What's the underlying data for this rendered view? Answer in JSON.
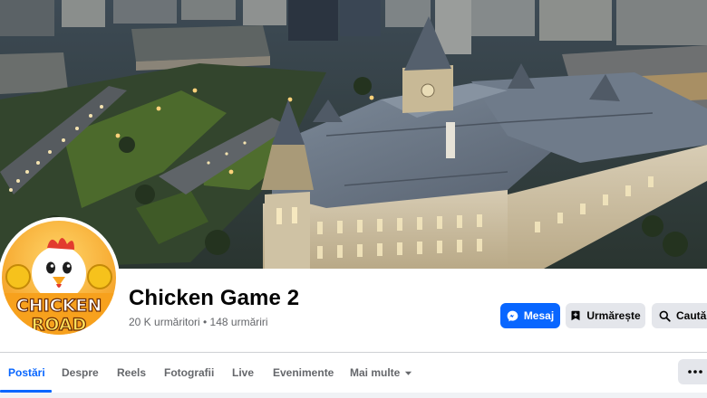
{
  "page": {
    "name": "Chicken Game 2",
    "stats": "20 K urmăritori • 148 urmăriri"
  },
  "avatar": {
    "logo_text_line1": "CHICKEN",
    "logo_text_line2": "ROAD"
  },
  "actions": {
    "message_label": "Mesaj",
    "follow_label": "Urmărește",
    "search_label": "Caută"
  },
  "tabs": [
    {
      "label": "Postări",
      "active": true
    },
    {
      "label": "Despre",
      "active": false
    },
    {
      "label": "Reels",
      "active": false
    },
    {
      "label": "Fotografii",
      "active": false
    },
    {
      "label": "Live",
      "active": false
    },
    {
      "label": "Evenimente",
      "active": false
    },
    {
      "label": "Mai multe",
      "active": false
    }
  ],
  "icons": {
    "messenger": "messenger-icon",
    "follow": "follow-icon",
    "search": "search-icon",
    "dropdown": "caret-down-icon",
    "more": "more-options-icon"
  },
  "colors": {
    "accent": "#0866ff",
    "button_gray": "#e4e6eb",
    "secondary_text": "#65676b",
    "divider": "#ced0d4"
  }
}
